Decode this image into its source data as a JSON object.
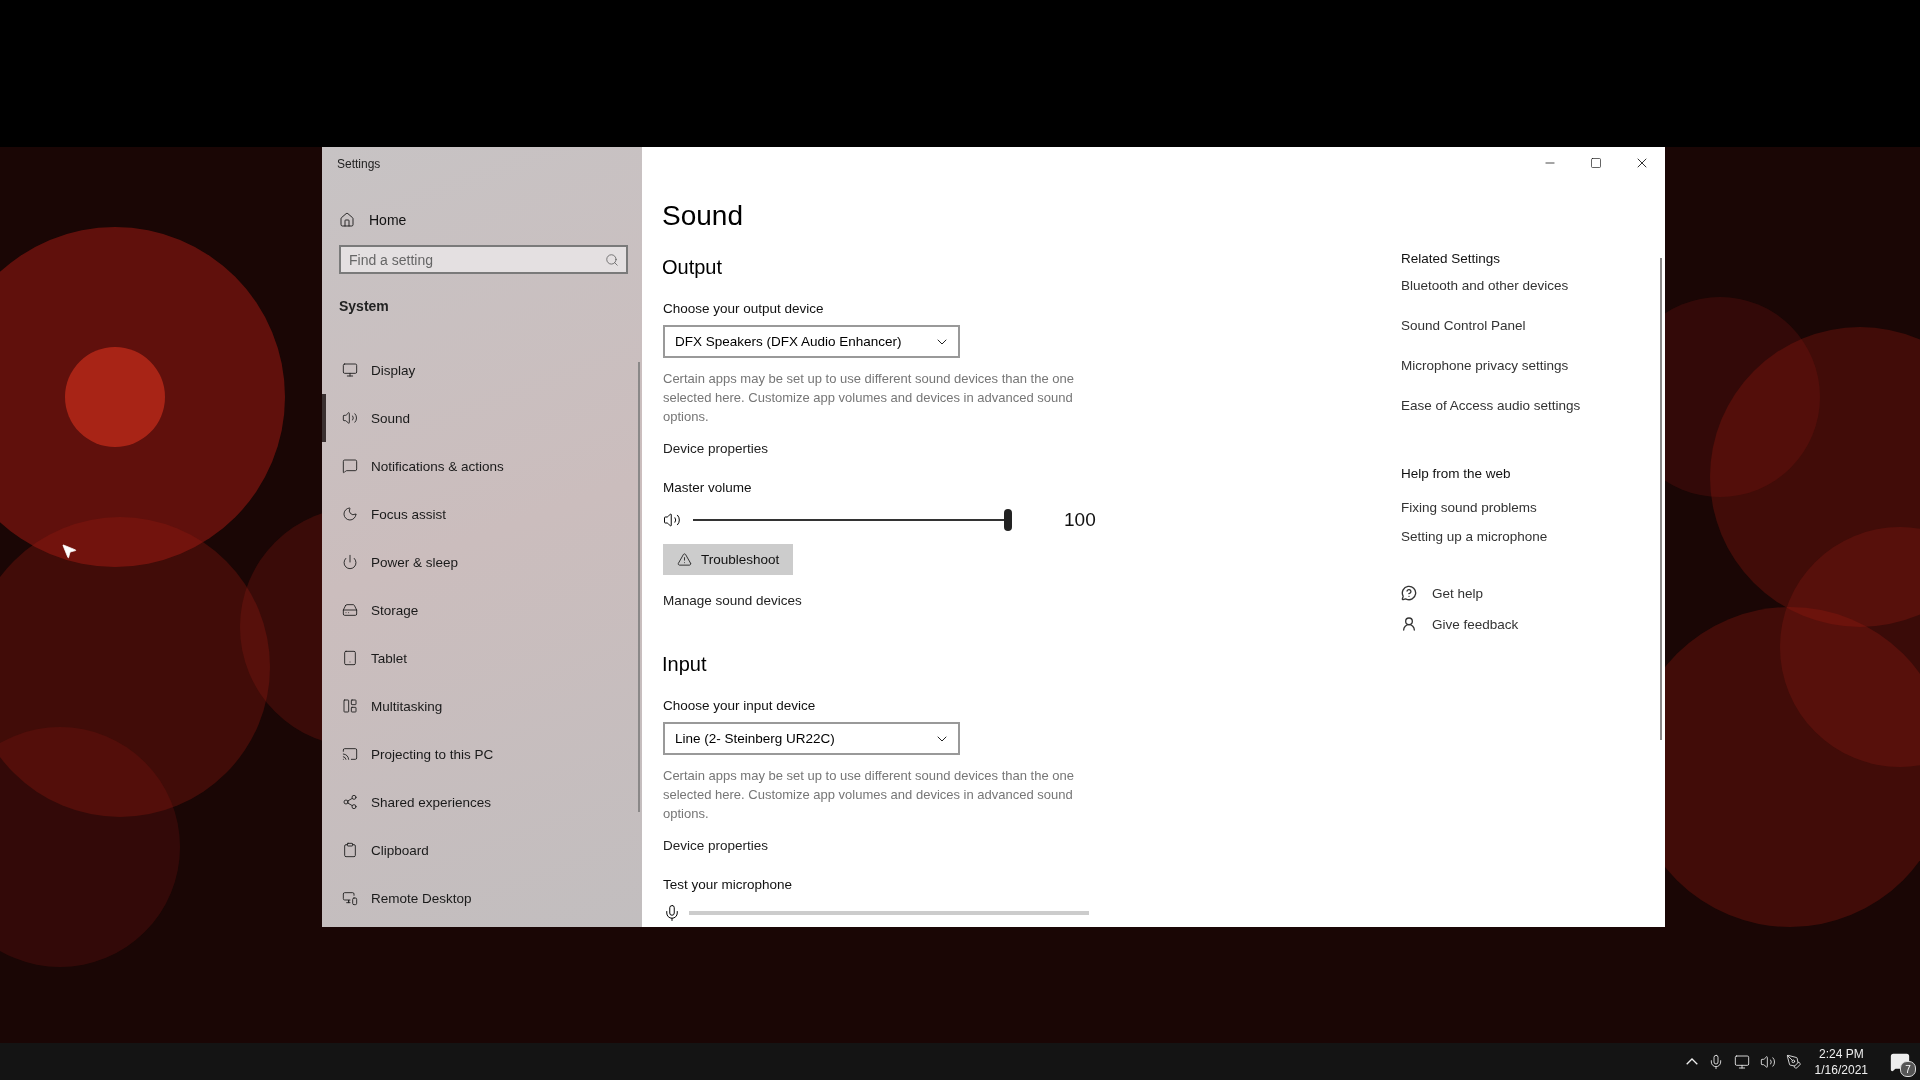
{
  "window": {
    "title": "Settings"
  },
  "sidebar": {
    "home": "Home",
    "search": {
      "placeholder": "Find a setting"
    },
    "section": "System",
    "items": [
      {
        "label": "Display",
        "selected": false
      },
      {
        "label": "Sound",
        "selected": true
      },
      {
        "label": "Notifications & actions",
        "selected": false
      },
      {
        "label": "Focus assist",
        "selected": false
      },
      {
        "label": "Power & sleep",
        "selected": false
      },
      {
        "label": "Storage",
        "selected": false
      },
      {
        "label": "Tablet",
        "selected": false
      },
      {
        "label": "Multitasking",
        "selected": false
      },
      {
        "label": "Projecting to this PC",
        "selected": false
      },
      {
        "label": "Shared experiences",
        "selected": false
      },
      {
        "label": "Clipboard",
        "selected": false
      },
      {
        "label": "Remote Desktop",
        "selected": false
      }
    ]
  },
  "page": {
    "title": "Sound"
  },
  "output": {
    "heading": "Output",
    "device_label": "Choose your output device",
    "device": "DFX Speakers (DFX Audio Enhancer)",
    "note": "Certain apps may be set up to use different sound devices than the one selected here. Customize app volumes and devices in advanced sound options.",
    "properties_link": "Device properties",
    "volume_label": "Master volume",
    "volume": {
      "level": 1,
      "reading": "100"
    },
    "troubleshoot": "Troubleshoot",
    "manage_link": "Manage sound devices"
  },
  "input": {
    "heading": "Input",
    "device_label": "Choose your input device",
    "device": "Line (2- Steinberg UR22C)",
    "note": "Certain apps may be set up to use different sound devices than the one selected here. Customize app volumes and devices in advanced sound options.",
    "properties_link": "Device properties",
    "test_label": "Test your microphone"
  },
  "related": {
    "heading": "Related Settings",
    "links": [
      "Bluetooth and other devices",
      "Sound Control Panel",
      "Microphone privacy settings",
      "Ease of Access audio settings"
    ]
  },
  "web_help": {
    "heading": "Help from the web",
    "links": [
      "Fixing sound problems",
      "Setting up a microphone"
    ]
  },
  "support": [
    "Get help",
    "Give feedback"
  ],
  "taskbar": {
    "time": "2:24 PM",
    "date": "1/16/2021",
    "notification_count": "7"
  }
}
